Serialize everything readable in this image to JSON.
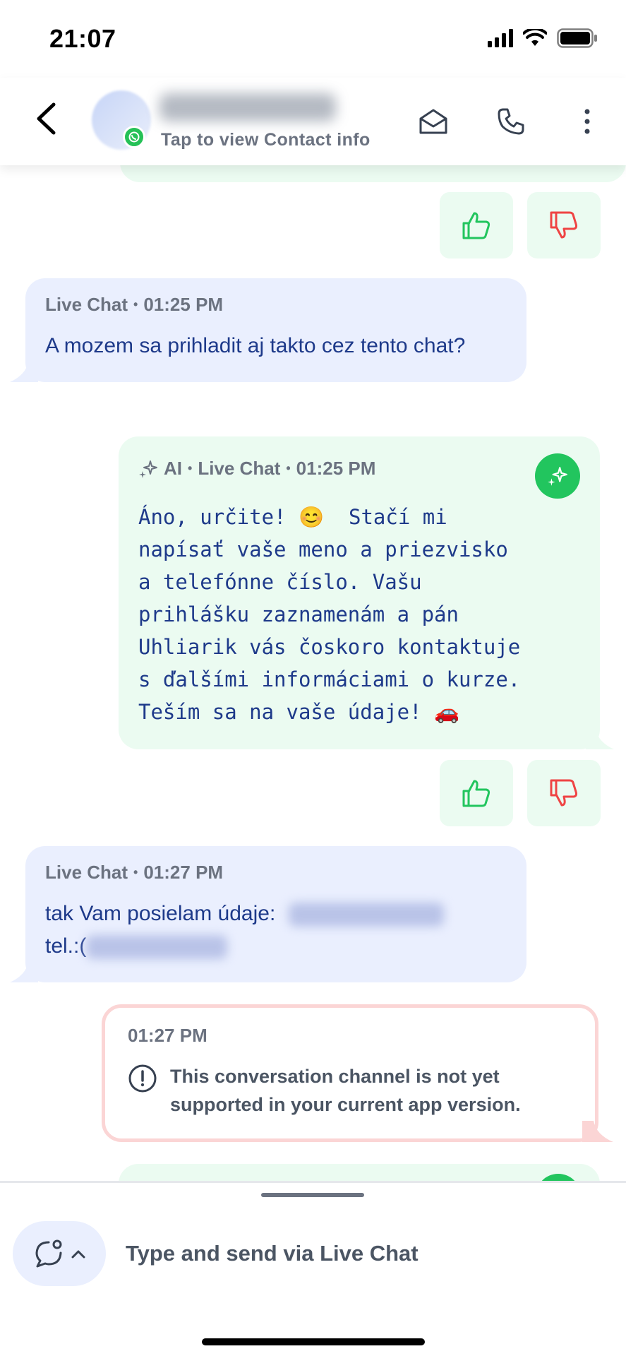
{
  "status_bar": {
    "time": "21:07"
  },
  "header": {
    "subtitle": "Tap to view Contact info"
  },
  "messages": [
    {
      "id": "m1",
      "channel": "Live Chat",
      "time": "01:25 PM",
      "text": "A mozem sa prihladit aj takto cez tento chat?"
    },
    {
      "id": "m2",
      "sender": "AI",
      "channel": "Live Chat",
      "time": "01:25 PM",
      "text": "Áno, určite! 😊  Stačí mi\nnapísať vaše meno a priezvisko\na telefónne číslo. Vašu\nprihlášku zaznamenám a pán\nUhliarik vás čoskoro kontaktuje\ns ďalšími informáciami o kurze.\nTeším sa na vaše údaje! 🚗"
    },
    {
      "id": "m3",
      "channel": "Live Chat",
      "time": "01:27 PM",
      "text_line1": "tak Vam posielam údaje:",
      "text_line2": "tel.:("
    },
    {
      "id": "m4",
      "time": "01:27 PM",
      "warning": "This conversation channel is not yet supported in your current app version."
    }
  ],
  "composer": {
    "placeholder": "Type and send via Live Chat"
  },
  "colors": {
    "incoming_bg": "#eaeffe",
    "outgoing_bg": "#ebfbf1",
    "accent_green": "#22c55e",
    "thumb_up": "#22c55e",
    "thumb_down": "#ef4444",
    "warn_border": "#fbd5d5"
  }
}
